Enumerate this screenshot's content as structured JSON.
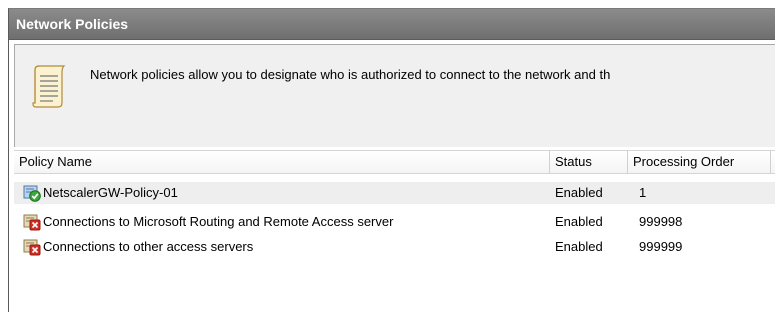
{
  "panel": {
    "title": "Network Policies"
  },
  "info": {
    "icon": "note-icon",
    "text": "Network policies allow you to designate who is authorized to connect to the network and th"
  },
  "table": {
    "columns": [
      "Policy Name",
      "Status",
      "Processing Order"
    ],
    "rows": [
      {
        "icon": "policy-enabled-icon",
        "name": "NetscalerGW-Policy-01",
        "status": "Enabled",
        "order": "1"
      },
      {
        "icon": "policy-deny-icon",
        "name": "Connections to Microsoft Routing and Remote Access server",
        "status": "Enabled",
        "order": "999998"
      },
      {
        "icon": "policy-deny-icon",
        "name": "Connections to other access servers",
        "status": "Enabled",
        "order": "999999"
      }
    ]
  }
}
